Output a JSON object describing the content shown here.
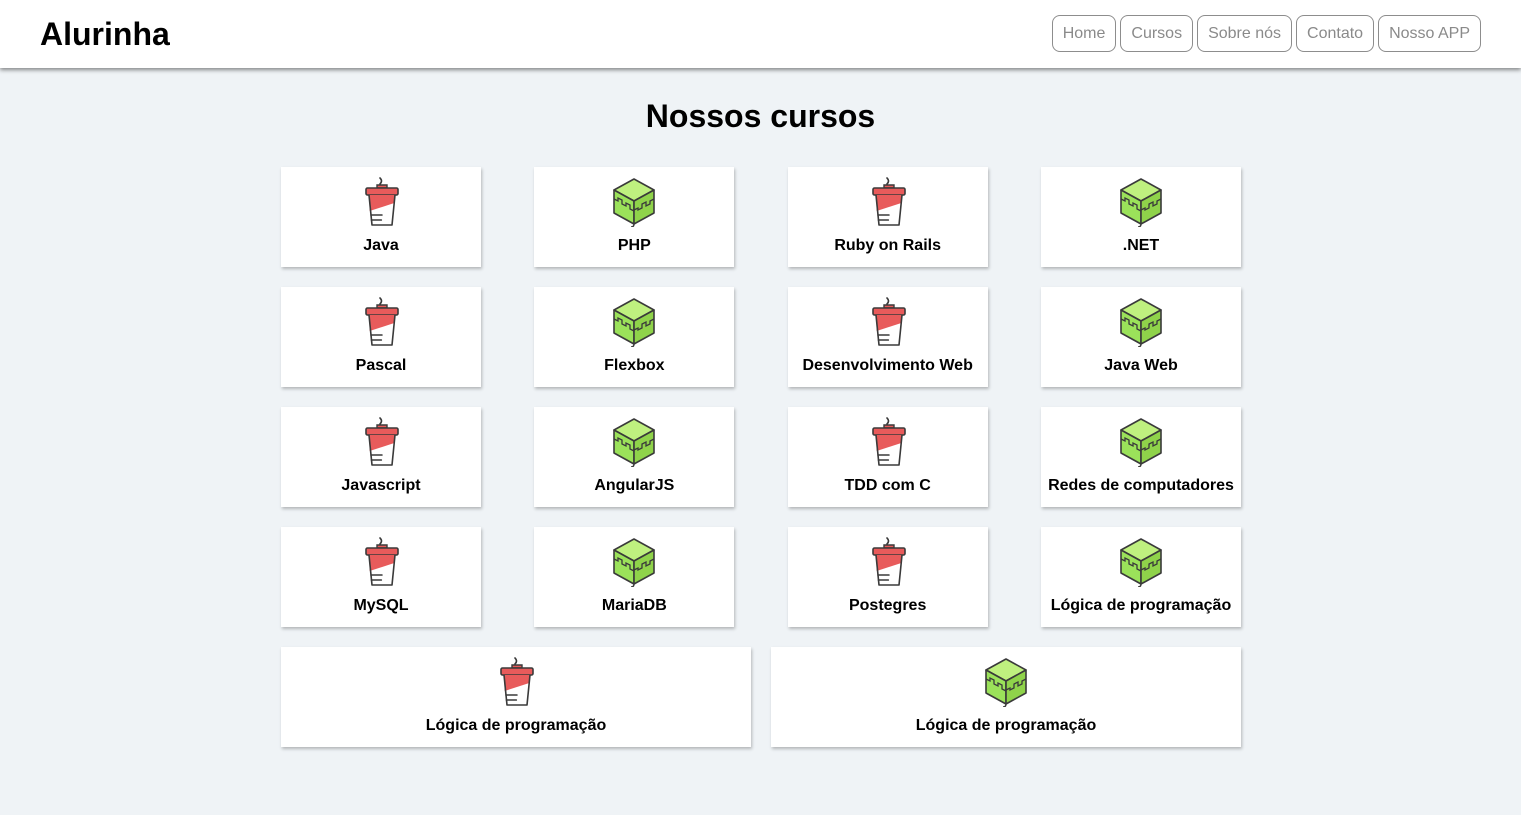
{
  "header": {
    "logo": "Alurinha",
    "nav": [
      "Home",
      "Cursos",
      "Sobre nós",
      "Contato",
      "Nosso APP"
    ]
  },
  "main": {
    "title": "Nossos cursos",
    "courses": [
      {
        "label": "Java",
        "icon": "coffee-cup-icon"
      },
      {
        "label": "PHP",
        "icon": "green-cube-icon"
      },
      {
        "label": "Ruby on Rails",
        "icon": "coffee-cup-icon"
      },
      {
        "label": ".NET",
        "icon": "green-cube-icon"
      },
      {
        "label": "Pascal",
        "icon": "coffee-cup-icon"
      },
      {
        "label": "Flexbox",
        "icon": "green-cube-icon"
      },
      {
        "label": "Desenvolvimento Web",
        "icon": "coffee-cup-icon"
      },
      {
        "label": "Java Web",
        "icon": "green-cube-icon"
      },
      {
        "label": "Javascript",
        "icon": "coffee-cup-icon"
      },
      {
        "label": "AngularJS",
        "icon": "green-cube-icon"
      },
      {
        "label": "TDD com C",
        "icon": "coffee-cup-icon"
      },
      {
        "label": "Redes de computadores",
        "icon": "green-cube-icon"
      },
      {
        "label": "MySQL",
        "icon": "coffee-cup-icon"
      },
      {
        "label": "MariaDB",
        "icon": "green-cube-icon"
      },
      {
        "label": "Postegres",
        "icon": "coffee-cup-icon"
      },
      {
        "label": "Lógica de programação",
        "icon": "green-cube-icon"
      },
      {
        "label": "Lógica de programação",
        "icon": "coffee-cup-icon"
      },
      {
        "label": "Lógica de programação",
        "icon": "green-cube-icon"
      }
    ]
  },
  "colors": {
    "background": "#eff3f6",
    "cup_red": "#e85b5b",
    "cube_green": "#9be25a",
    "outline": "#3a3a3a"
  }
}
